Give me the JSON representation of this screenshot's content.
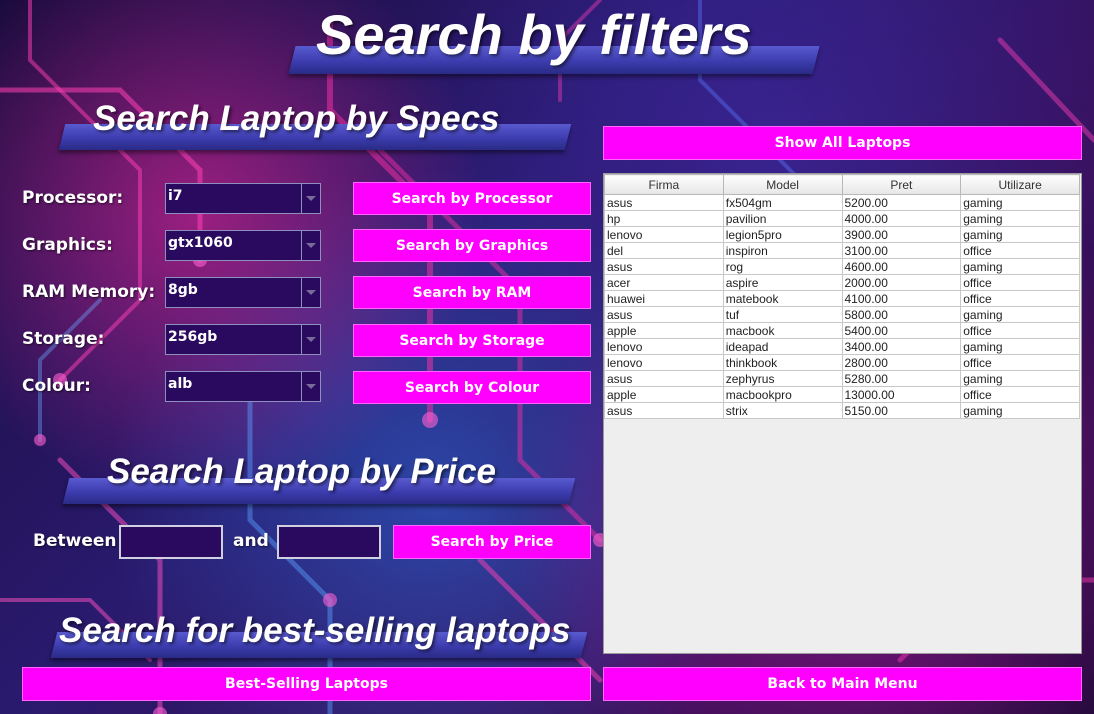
{
  "title": "Search by filters",
  "specs_section": {
    "heading": "Search Laptop by Specs",
    "filters": [
      {
        "label": "Processor:",
        "value": "i7",
        "button": "Search by Processor"
      },
      {
        "label": "Graphics:",
        "value": "gtx1060",
        "button": "Search by Graphics"
      },
      {
        "label": "RAM Memory:",
        "value": "8gb",
        "button": "Search by RAM"
      },
      {
        "label": "Storage:",
        "value": "256gb",
        "button": "Search by Storage"
      },
      {
        "label": "Colour:",
        "value": "alb",
        "button": "Search by Colour"
      }
    ]
  },
  "price_section": {
    "heading": "Search Laptop by Price",
    "between_label": "Between",
    "and_label": "and",
    "min_value": "",
    "max_value": "",
    "button": "Search by Price"
  },
  "bestselling_section": {
    "heading": "Search for best-selling laptops",
    "button": "Best-Selling Laptops"
  },
  "show_all_button": "Show All Laptops",
  "back_button": "Back to Main Menu",
  "table": {
    "columns": [
      "Firma",
      "Model",
      "Pret",
      "Utilizare"
    ],
    "rows": [
      [
        "asus",
        "fx504gm",
        "5200.00",
        "gaming"
      ],
      [
        "hp",
        "pavilion",
        "4000.00",
        "gaming"
      ],
      [
        "lenovo",
        "legion5pro",
        "3900.00",
        "gaming"
      ],
      [
        "del",
        "inspiron",
        "3100.00",
        "office"
      ],
      [
        "asus",
        "rog",
        "4600.00",
        "gaming"
      ],
      [
        "acer",
        "aspire",
        "2000.00",
        "office"
      ],
      [
        "huawei",
        "matebook",
        "4100.00",
        "office"
      ],
      [
        "asus",
        "tuf",
        "5800.00",
        "gaming"
      ],
      [
        "apple",
        "macbook",
        "5400.00",
        "office"
      ],
      [
        "lenovo",
        "ideapad",
        "3400.00",
        "gaming"
      ],
      [
        "lenovo",
        "thinkbook",
        "2800.00",
        "office"
      ],
      [
        "asus",
        "zephyrus",
        "5280.00",
        "gaming"
      ],
      [
        "apple",
        "macbookpro",
        "13000.00",
        "office"
      ],
      [
        "asus",
        "strix",
        "5150.00",
        "gaming"
      ]
    ]
  },
  "colors": {
    "button": "#ff00ff",
    "field_bg": "#2a0a5e",
    "ribbon": "#3c3cae"
  }
}
